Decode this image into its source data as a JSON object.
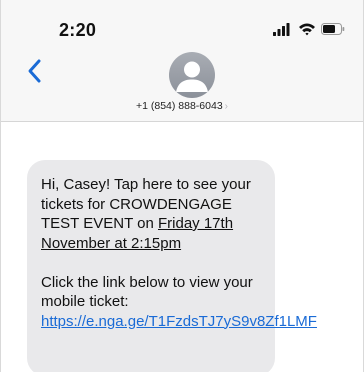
{
  "status_bar": {
    "time": "2:20"
  },
  "header": {
    "contact": "+1 (854) 888-6043",
    "chevron": "›"
  },
  "message": {
    "line1_pre": "Hi, Casey! Tap here to see your tickets for CROWDENGAGE TEST EVENT on ",
    "date_text": "Friday 17th November at 2:15pm",
    "line2": "Click the link below to view your mobile ticket:",
    "link_text": "https://e.nga.ge/T1FzdsTJ7yS9v8Zf1LMF"
  }
}
